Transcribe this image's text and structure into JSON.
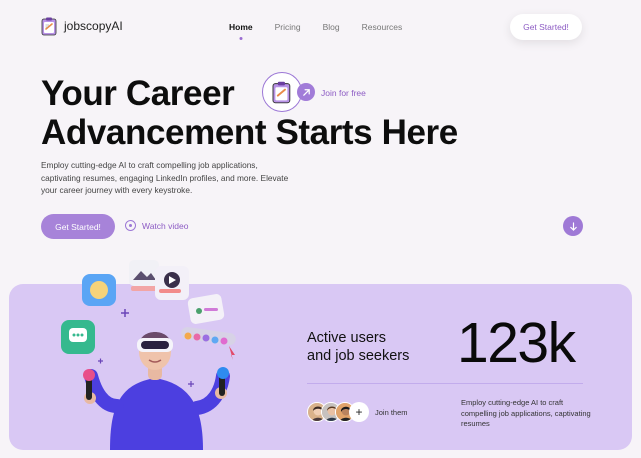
{
  "brand": {
    "name": "jobscopyAI"
  },
  "nav": {
    "items": [
      {
        "label": "Home",
        "active": true
      },
      {
        "label": "Pricing",
        "active": false
      },
      {
        "label": "Blog",
        "active": false
      },
      {
        "label": "Resources",
        "active": false
      }
    ],
    "cta_label": "Get Started!"
  },
  "hero": {
    "title_line1": "Your Career",
    "title_line2": "Advancement Starts Here",
    "join_label": "Join for free",
    "lead": "Employ cutting-edge AI to craft compelling job applications, captivating resumes, engaging LinkedIn profiles, and more. Elevate your career journey with every keystroke.",
    "primary_button": "Get Started!",
    "watch_label": "Watch video"
  },
  "stats": {
    "label_line1": "Active users",
    "label_line2": "and job seekers",
    "number": "123k",
    "join_text": "Join them",
    "description": "Employ cutting-edge AI to craft compelling job applications, captivating resumes"
  },
  "colors": {
    "accent": "#9c77d6",
    "panel_bg": "#d9c8f4",
    "page_bg": "#f7f4f8"
  },
  "icons": [
    "logo-icon",
    "arrow-up-right-icon",
    "play-circle-icon",
    "arrow-down-icon",
    "plus-icon"
  ]
}
